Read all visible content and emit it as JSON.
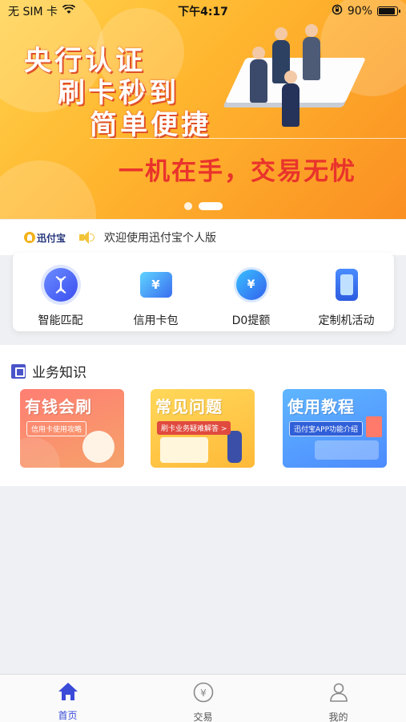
{
  "status_bar": {
    "carrier": "无 SIM 卡",
    "time": "下午4:17",
    "battery_percent": "90%",
    "battery_level": 0.9
  },
  "banner": {
    "headline_lines": [
      "央行认证",
      "刷卡秒到",
      "简单便捷"
    ],
    "slogan": "一机在手，交易无忧",
    "slide_count": 2,
    "active_slide": 2
  },
  "notice": {
    "brand": "迅付宝",
    "text": "欢迎使用迅付宝个人版"
  },
  "quick_entries": [
    {
      "label": "智能匹配",
      "icon": "dna-icon"
    },
    {
      "label": "信用卡包",
      "icon": "card-wallet-icon",
      "glyph": "¥"
    },
    {
      "label": "D0提额",
      "icon": "coin-icon",
      "glyph": "¥"
    },
    {
      "label": "定制机活动",
      "icon": "pos-device-icon"
    }
  ],
  "knowledge": {
    "title": "业务知识",
    "cards": [
      {
        "title": "有钱会刷",
        "subtitle": "信用卡使用攻略"
      },
      {
        "title": "常见问题",
        "subtitle": "刷卡业务疑难解答 >"
      },
      {
        "title": "使用教程",
        "subtitle": "迅付宝APP功能介绍"
      }
    ]
  },
  "tabbar": {
    "tabs": [
      {
        "label": "首页",
        "icon": "home-icon",
        "active": true
      },
      {
        "label": "交易",
        "icon": "yuan-circle-icon",
        "active": false
      },
      {
        "label": "我的",
        "icon": "user-icon",
        "active": false
      }
    ],
    "active_color": "#3a4bd8",
    "inactive_color": "#888888"
  }
}
